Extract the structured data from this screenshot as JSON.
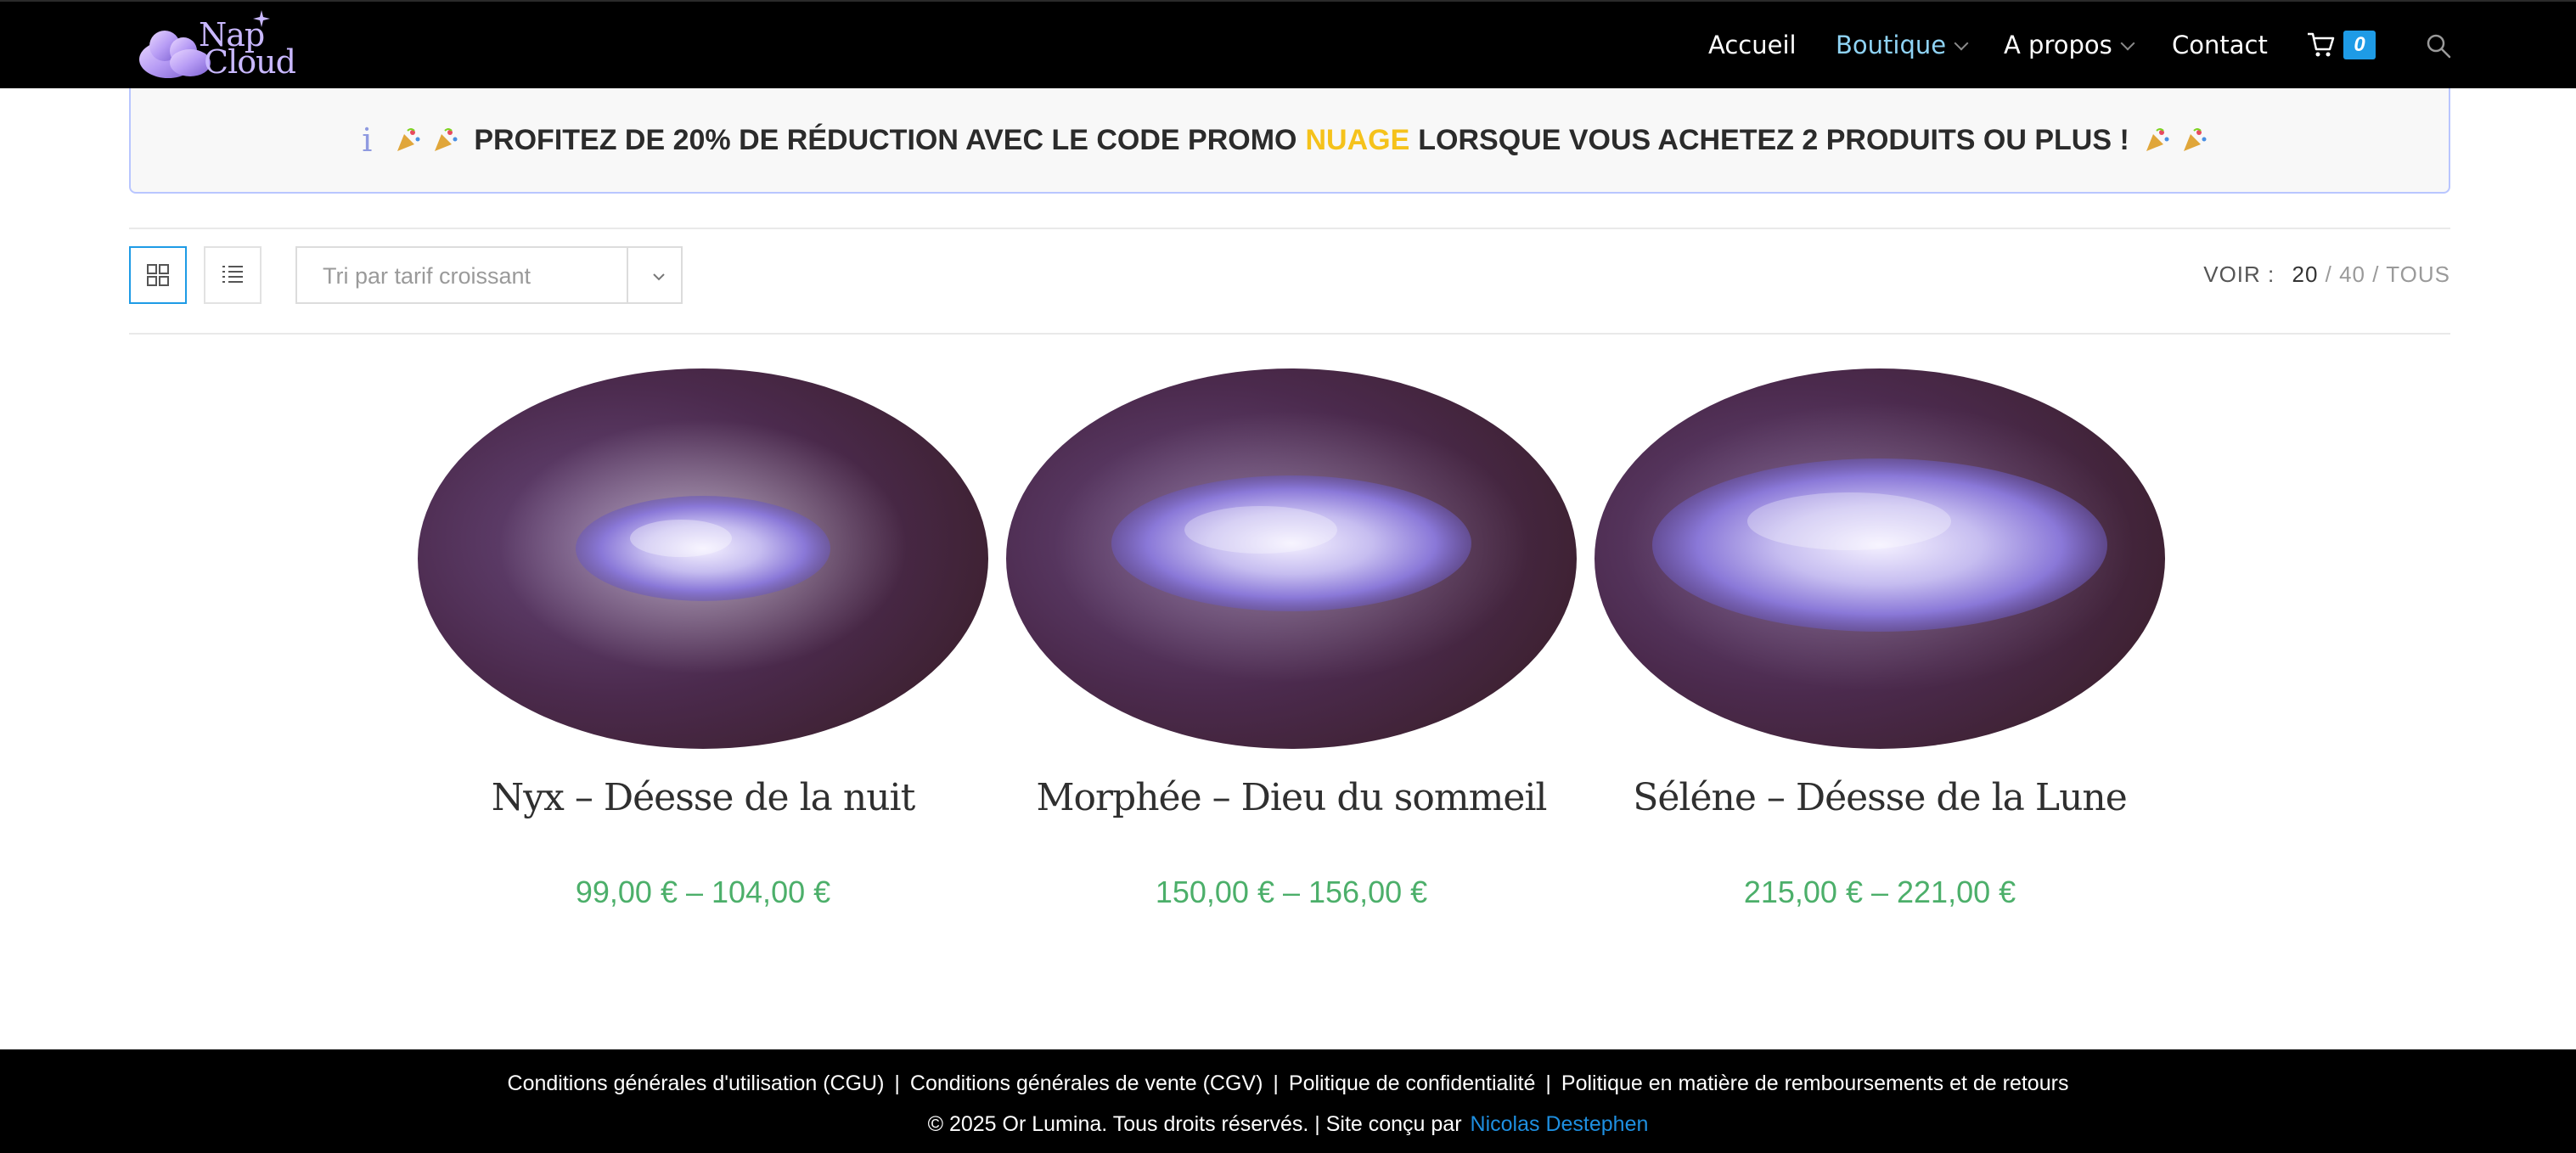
{
  "header": {
    "logo_line1": "Nap",
    "logo_line2": "Cloud",
    "nav": [
      {
        "label": "Accueil"
      },
      {
        "label": "Boutique"
      },
      {
        "label": "A propos"
      },
      {
        "label": "Contact"
      }
    ],
    "cart_count": "0",
    "colors": {
      "active_nav": "#8fd3f4",
      "badge": "#1e9be6"
    }
  },
  "promo": {
    "text_before": "PROFITEZ DE 20% DE RÉDUCTION AVEC LE CODE PROMO",
    "code": "NUAGE",
    "text_after": "LORSQUE VOUS ACHETEZ 2 PRODUITS OU PLUS !",
    "info_icon": "i",
    "colors": {
      "code": "#f5c21b"
    }
  },
  "toolbar": {
    "sort_selected": "Tri par tarif croissant",
    "per_page_label": "VOIR :",
    "per_page_options": [
      "20",
      "40",
      "TOUS"
    ]
  },
  "products": [
    {
      "title": "Nyx – Déesse de la nuit",
      "price": "99,00 € – 104,00 €"
    },
    {
      "title": "Morphée – Dieu du sommeil",
      "price": "150,00 € – 156,00 €"
    },
    {
      "title": "Séléne – Déesse de la Lune",
      "price": "215,00 € – 221,00 €"
    }
  ],
  "footer": {
    "links": [
      "Conditions générales d'utilisation (CGU)",
      "Conditions générales de vente (CGV)",
      "Politique de confidentialité",
      "Politique en matière de remboursements et de retours"
    ],
    "copyright": "© 2025 Or Lumina. Tous droits réservés. | Site conçu par",
    "designer": "Nicolas Destephen"
  }
}
